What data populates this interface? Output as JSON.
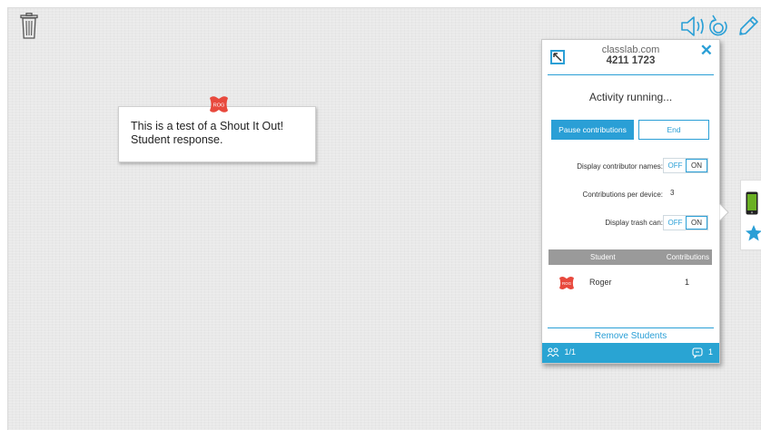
{
  "toolbar": {
    "icons": [
      "trash-icon",
      "speaker-icon",
      "refresh-icon",
      "pencil-icon"
    ]
  },
  "response_card": {
    "avatar_initials": "ROG",
    "text": "This is a test of a Shout It Out! Student response."
  },
  "panel": {
    "host": "classlab.com",
    "code": "4211 1723",
    "status": "Activity running...",
    "pause_label": "Pause contributions",
    "end_label": "End",
    "settings": [
      {
        "label": "Display contributor names:",
        "off": "OFF",
        "on": "ON",
        "selected": "ON"
      },
      {
        "label": "Contributions per device:",
        "value": "3"
      },
      {
        "label": "Display trash can:",
        "off": "OFF",
        "on": "ON",
        "selected": "ON"
      }
    ],
    "table": {
      "columns": [
        "Student",
        "Contributions"
      ],
      "rows": [
        {
          "initials": "ROG",
          "name": "Roger",
          "contributions": "1"
        }
      ]
    },
    "remove_students": "Remove Students",
    "footer": {
      "participants": "1/1",
      "responses": "1"
    }
  },
  "colors": {
    "accent": "#2a9fd6",
    "footer": "#29a4d3",
    "avatar": "#e8493d",
    "phone": "#6ab023",
    "star": "#2a9fd6"
  }
}
